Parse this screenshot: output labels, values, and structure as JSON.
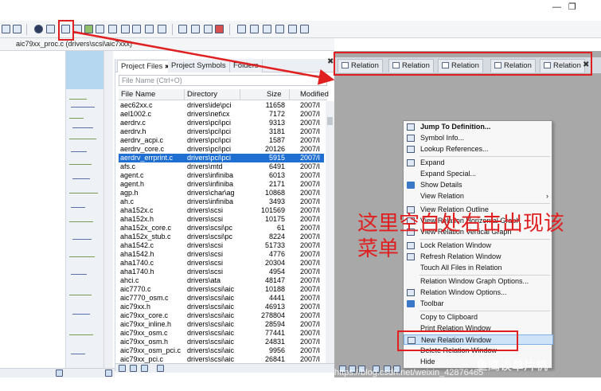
{
  "window": {
    "minimize_glyph": "—",
    "restore_glyph": "❐"
  },
  "file_tab": {
    "label": "aic79xx_proc.c (drivers\\scsi\\aic7xxx)"
  },
  "project_panel": {
    "tabs": [
      {
        "label": "Project Files",
        "close": "✖"
      },
      {
        "label": "Project Symbols"
      },
      {
        "label": "Folders"
      }
    ],
    "panel_close": "✖",
    "filter_placeholder": "File Name (Ctrl+O)",
    "columns": [
      "File Name",
      "Directory",
      "Size",
      "Modified"
    ],
    "rows": [
      {
        "name": "aec62xx.c",
        "dir": "drivers\\ide\\pci",
        "size": "11658",
        "mod": "2007/I"
      },
      {
        "name": "ael1002.c",
        "dir": "drivers\\net\\cx",
        "size": "7172",
        "mod": "2007/I"
      },
      {
        "name": "aerdrv.c",
        "dir": "drivers\\pci\\pci",
        "size": "9313",
        "mod": "2007/I"
      },
      {
        "name": "aerdrv.h",
        "dir": "drivers\\pci\\pci",
        "size": "3181",
        "mod": "2007/I"
      },
      {
        "name": "aerdrv_acpi.c",
        "dir": "drivers\\pci\\pci",
        "size": "1587",
        "mod": "2007/I"
      },
      {
        "name": "aerdrv_core.c",
        "dir": "drivers\\pci\\pci",
        "size": "20126",
        "mod": "2007/I"
      },
      {
        "name": "aerdrv_errprint.c",
        "dir": "drivers\\pci\\pci",
        "size": "5915",
        "mod": "2007/I",
        "selected": true
      },
      {
        "name": "afs.c",
        "dir": "drivers\\mtd",
        "size": "6491",
        "mod": "2007/I"
      },
      {
        "name": "agent.c",
        "dir": "drivers\\infiniba",
        "size": "6013",
        "mod": "2007/I"
      },
      {
        "name": "agent.h",
        "dir": "drivers\\infiniba",
        "size": "2171",
        "mod": "2007/I"
      },
      {
        "name": "agp.h",
        "dir": "drivers\\char\\ag",
        "size": "10868",
        "mod": "2007/I"
      },
      {
        "name": "ah.c",
        "dir": "drivers\\infiniba",
        "size": "3493",
        "mod": "2007/I"
      },
      {
        "name": "aha152x.c",
        "dir": "drivers\\scsi",
        "size": "101569",
        "mod": "2007/I"
      },
      {
        "name": "aha152x.h",
        "dir": "drivers\\scsi",
        "size": "10175",
        "mod": "2007/I"
      },
      {
        "name": "aha152x_core.c",
        "dir": "drivers\\scsi\\pc",
        "size": "61",
        "mod": "2007/I"
      },
      {
        "name": "aha152x_stub.c",
        "dir": "drivers\\scsi\\pc",
        "size": "8224",
        "mod": "2007/I"
      },
      {
        "name": "aha1542.c",
        "dir": "drivers\\scsi",
        "size": "51733",
        "mod": "2007/I"
      },
      {
        "name": "aha1542.h",
        "dir": "drivers\\scsi",
        "size": "4776",
        "mod": "2007/I"
      },
      {
        "name": "aha1740.c",
        "dir": "drivers\\scsi",
        "size": "20304",
        "mod": "2007/I"
      },
      {
        "name": "aha1740.h",
        "dir": "drivers\\scsi",
        "size": "4954",
        "mod": "2007/I"
      },
      {
        "name": "ahci.c",
        "dir": "drivers\\ata",
        "size": "48147",
        "mod": "2007/I"
      },
      {
        "name": "aic7770.c",
        "dir": "drivers\\scsi\\aic",
        "size": "10188",
        "mod": "2007/I"
      },
      {
        "name": "aic7770_osm.c",
        "dir": "drivers\\scsi\\aic",
        "size": "4441",
        "mod": "2007/I"
      },
      {
        "name": "aic79xx.h",
        "dir": "drivers\\scsi\\aic",
        "size": "46913",
        "mod": "2007/I"
      },
      {
        "name": "aic79xx_core.c",
        "dir": "drivers\\scsi\\aic",
        "size": "278804",
        "mod": "2007/I"
      },
      {
        "name": "aic79xx_inline.h",
        "dir": "drivers\\scsi\\aic",
        "size": "28594",
        "mod": "2007/I"
      },
      {
        "name": "aic79xx_osm.c",
        "dir": "drivers\\scsi\\aic",
        "size": "77441",
        "mod": "2007/I"
      },
      {
        "name": "aic79xx_osm.h",
        "dir": "drivers\\scsi\\aic",
        "size": "24831",
        "mod": "2007/I"
      },
      {
        "name": "aic79xx_osm_pci.c",
        "dir": "drivers\\scsi\\aic",
        "size": "9956",
        "mod": "2007/I"
      },
      {
        "name": "aic79xx_pci.c",
        "dir": "drivers\\scsi\\aic",
        "size": "26841",
        "mod": "2007/I"
      }
    ]
  },
  "relation_window": {
    "tabs": [
      {
        "label": "Relation"
      },
      {
        "label": "Relation"
      },
      {
        "label": "Relation"
      },
      {
        "label": "Relation"
      },
      {
        "label": "Relation"
      }
    ],
    "tab_close": "✖",
    "outer_close": "✖"
  },
  "context_menu": {
    "items": [
      {
        "label": "Jump To Definition...",
        "bold": true,
        "icon": "jump-icon"
      },
      {
        "label": "Symbol Info...",
        "icon": "info-icon"
      },
      {
        "label": "Lookup References...",
        "icon": "reference-icon"
      },
      {
        "sep": true
      },
      {
        "label": "Expand",
        "icon": "expand-icon"
      },
      {
        "label": "Expand Special..."
      },
      {
        "label": "Show Details",
        "icon": "check-icon",
        "checked": true
      },
      {
        "label": "View Relation",
        "submenu": true,
        "arrow": "›"
      },
      {
        "sep": true
      },
      {
        "label": "View Relation Outline",
        "icon": "outline-icon"
      },
      {
        "label": "View Relation Horizontal Graph",
        "icon": "hgraph-icon"
      },
      {
        "label": "View Relation Vertical Graph",
        "icon": "vgraph-icon"
      },
      {
        "sep": true
      },
      {
        "label": "Lock Relation Window",
        "icon": "lock-icon"
      },
      {
        "label": "Refresh Relation Window",
        "icon": "refresh-icon"
      },
      {
        "label": "Touch All Files in Relation"
      },
      {
        "sep": true
      },
      {
        "label": "Relation Window Graph Options..."
      },
      {
        "label": "Relation Window Options...",
        "icon": "gear-icon"
      },
      {
        "label": "Toolbar",
        "icon": "check-icon",
        "checked": true
      },
      {
        "sep": true
      },
      {
        "label": "Copy to Clipboard"
      },
      {
        "label": "Print Relation Window"
      },
      {
        "label": "New Relation Window",
        "icon": "new-window-icon",
        "highlighted": true
      },
      {
        "label": "Delete Relation Window"
      },
      {
        "label": "Hide"
      }
    ]
  },
  "annotation": {
    "text": "这里空白处右击出现该菜单"
  },
  "watermark": {
    "text": "https://blog.csdn.net/weixin_42876465",
    "brand": "鱼鹰谈单片机"
  },
  "colors": {
    "accent": "#1e6fd1",
    "annotation": "#e02020",
    "relation_bg": "#a8a8a8"
  }
}
